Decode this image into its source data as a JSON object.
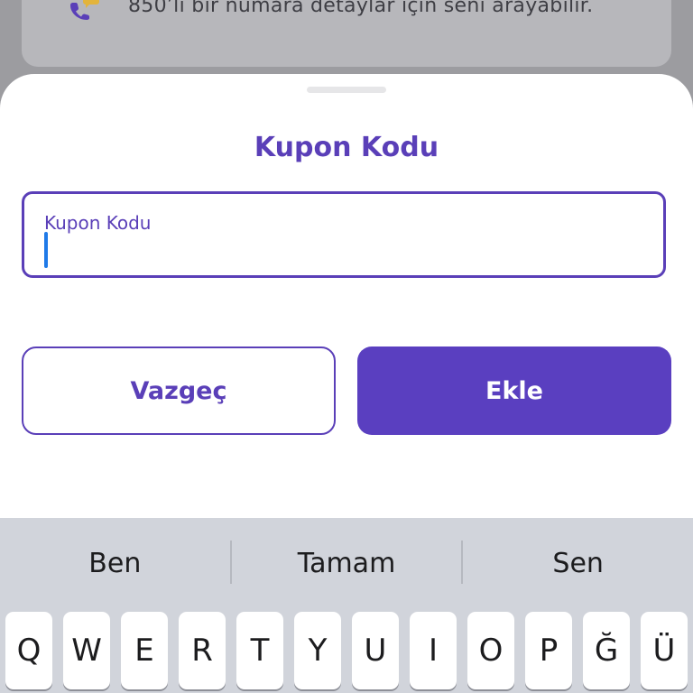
{
  "info_card": {
    "text": "850’li bir numara detaylar için seni arayabilir.",
    "icon": "phone-chat-icon",
    "icon_colors": {
      "phone": "#5a3fb8",
      "bubble": "#e3b43c"
    }
  },
  "sheet": {
    "title": "Kupon Kodu",
    "field_label": "Kupon Kodu",
    "field_value": "",
    "cancel_label": "Vazgeç",
    "add_label": "Ekle"
  },
  "keyboard": {
    "suggestions": [
      "Ben",
      "Tamam",
      "Sen"
    ],
    "row1": [
      "Q",
      "W",
      "E",
      "R",
      "T",
      "Y",
      "U",
      "I",
      "O",
      "P",
      "Ğ",
      "Ü"
    ]
  },
  "colors": {
    "accent": "#5a3fb8",
    "caret": "#1f7ae8",
    "keyboard_bg": "#d1d4db"
  }
}
